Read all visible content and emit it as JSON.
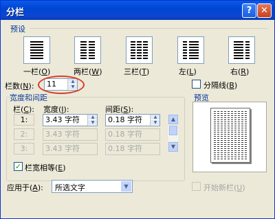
{
  "window": {
    "title": "分栏",
    "help_glyph": "?",
    "close_glyph": "✕"
  },
  "presets": {
    "section_label": "预设",
    "items": [
      {
        "label": "一栏",
        "key": "O"
      },
      {
        "label": "两栏",
        "key": "W"
      },
      {
        "label": "三栏",
        "key": "T"
      },
      {
        "label": "左",
        "key": "L"
      },
      {
        "label": "右",
        "key": "R"
      }
    ]
  },
  "columns": {
    "label": "栏数",
    "key": "N",
    "value": "11"
  },
  "separator": {
    "label": "分隔线",
    "key": "B",
    "checked": false
  },
  "width_spacing": {
    "section_label": "宽度和间距",
    "col_header": "栏",
    "col_key": "C",
    "width_header": "宽度",
    "width_key": "I",
    "spacing_header": "间距",
    "spacing_key": "S",
    "rows": [
      {
        "num": "1:",
        "width": "3.43 字符",
        "spacing": "0.18 字符",
        "enabled": true
      },
      {
        "num": "2:",
        "width": "3.43 字符",
        "spacing": "0.18 字符",
        "enabled": false
      },
      {
        "num": "3:",
        "width": "3.43 字符",
        "spacing": "0.18 字符",
        "enabled": false
      }
    ]
  },
  "equal_width": {
    "label": "栏宽相等",
    "key": "E",
    "checked": true
  },
  "apply_to": {
    "label": "应用于",
    "key": "A",
    "value": "所选文字"
  },
  "preview": {
    "label": "预览"
  },
  "new_column": {
    "label": "开始新栏",
    "key": "U",
    "checked": false
  }
}
